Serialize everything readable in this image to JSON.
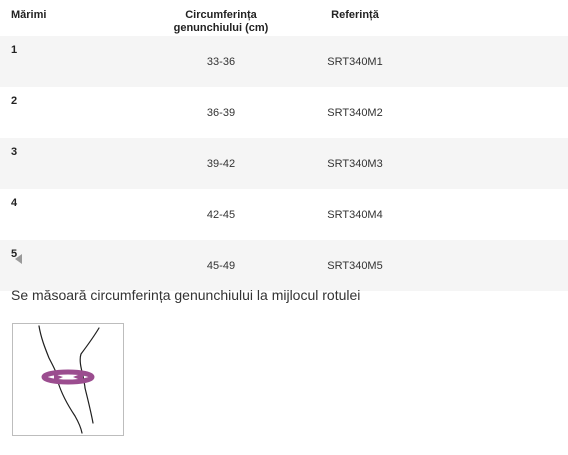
{
  "table": {
    "headers": {
      "size": "Mărimi",
      "circumference_line1": "Circumferința",
      "circumference_line2": "genunchiului (cm)",
      "reference": "Referință"
    },
    "rows": [
      {
        "size": "1",
        "circumference": "33-36",
        "reference": "SRT340M1"
      },
      {
        "size": "2",
        "circumference": "36-39",
        "reference": "SRT340M2"
      },
      {
        "size": "3",
        "circumference": "39-42",
        "reference": "SRT340M3"
      },
      {
        "size": "4",
        "circumference": "42-45",
        "reference": "SRT340M4"
      },
      {
        "size": "5",
        "circumference": "45-49",
        "reference": "SRT340M5"
      }
    ]
  },
  "note": "Se măsoară circumferința genunchiului la mijlocul rotulei",
  "icons": {
    "scroll": "caret-left-icon",
    "illustration": "knee-measurement-icon"
  },
  "colors": {
    "row_stripe": "#f5f5f5",
    "measure_band": "#9b4d8f"
  }
}
